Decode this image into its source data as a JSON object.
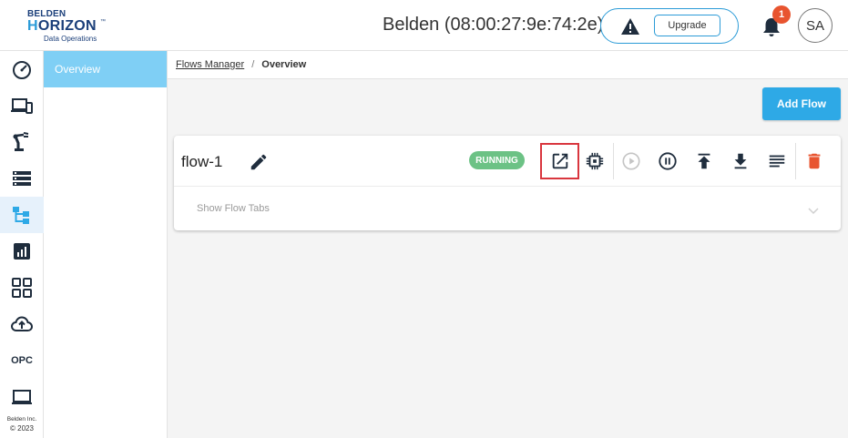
{
  "brand": {
    "line1": "BELDEN",
    "line2_a": "H",
    "line2_b": "ORIZON",
    "trademark": "™",
    "line3": "Data Operations"
  },
  "header": {
    "device_title": "Belden (08:00:27:9e:74:2e)",
    "upgrade_label": "Upgrade",
    "notification_count": "1",
    "avatar_initials": "SA"
  },
  "rail": {
    "items": [
      {
        "icon": "dashboard-gauge-icon"
      },
      {
        "icon": "devices-icon"
      },
      {
        "icon": "robot-arm-icon"
      },
      {
        "icon": "server-list-icon"
      },
      {
        "icon": "flows-icon",
        "active": true
      },
      {
        "icon": "analytics-icon"
      },
      {
        "icon": "apps-grid-icon"
      },
      {
        "icon": "cloud-upload-icon"
      },
      {
        "label": "OPC"
      },
      {
        "icon": "laptop-icon"
      }
    ],
    "footer_company": "Belden Inc.",
    "footer_copyright": "© 2023"
  },
  "subnav": {
    "items": [
      {
        "label": "Overview",
        "active": true
      }
    ]
  },
  "breadcrumb": {
    "parent": "Flows Manager",
    "separator": "/",
    "current": "Overview"
  },
  "actions": {
    "add_flow_label": "Add Flow"
  },
  "flows": [
    {
      "name": "flow-1",
      "status": "RUNNING",
      "status_color": "#6cc285",
      "tabs_label": "Show Flow Tabs",
      "action_icons": [
        "open-external-icon",
        "chip-icon",
        "play-icon",
        "pause-icon",
        "upload-icon",
        "download-icon",
        "logs-icon",
        "delete-icon"
      ]
    }
  ],
  "colors": {
    "accent": "#2ea9e6",
    "subnav_active": "#7fcff5",
    "danger": "#e8542f",
    "highlight_box": "#d9363e"
  }
}
